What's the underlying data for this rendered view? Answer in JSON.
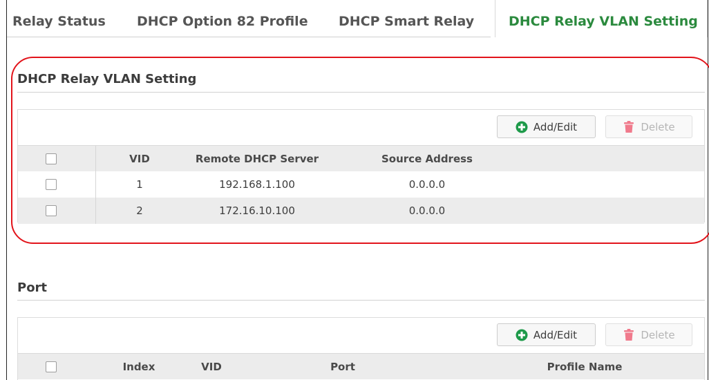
{
  "tabs": [
    {
      "label": "Relay Status"
    },
    {
      "label": "DHCP Option 82 Profile"
    },
    {
      "label": "DHCP Smart Relay"
    },
    {
      "label": "DHCP Relay VLAN Setting"
    }
  ],
  "colors": {
    "accent": "#2b8a3e",
    "add_icon": "#1e9a4a",
    "delete_icon": "#f07a8c",
    "highlight": "#e2131a"
  },
  "vlan_section": {
    "title": "DHCP Relay VLAN Setting",
    "add_label": "Add/Edit",
    "delete_label": "Delete",
    "columns": {
      "vid": "VID",
      "server": "Remote DHCP Server",
      "source": "Source Address"
    },
    "rows": [
      {
        "vid": "1",
        "server": "192.168.1.100",
        "source": "0.0.0.0"
      },
      {
        "vid": "2",
        "server": "172.16.10.100",
        "source": "0.0.0.0"
      }
    ]
  },
  "port_section": {
    "title": "Port",
    "add_label": "Add/Edit",
    "delete_label": "Delete",
    "columns": {
      "index": "Index",
      "vid": "VID",
      "port": "Port",
      "profile": "Profile Name"
    }
  }
}
